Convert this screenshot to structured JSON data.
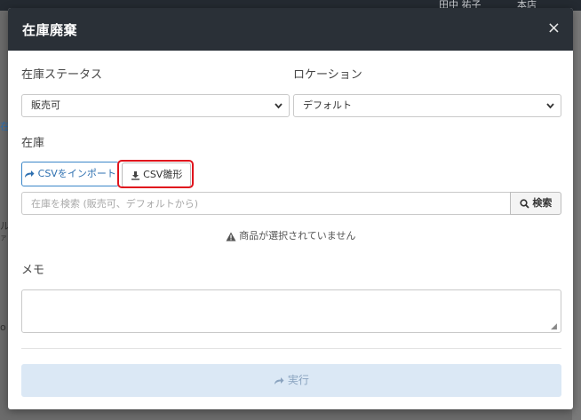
{
  "background": {
    "topbar_user": "田中 祐子",
    "topbar_store": "本店",
    "left_fragments": [
      "在",
      "ル",
      "ァ",
      "o"
    ]
  },
  "modal": {
    "title": "在庫廃棄",
    "close": "×",
    "status_label": "在庫ステータス",
    "status_value": "販売可",
    "location_label": "ロケーション",
    "location_value": "デフォルト",
    "stock_label": "在庫",
    "import_button": "CSVをインポート",
    "template_button": "CSV雛形",
    "search_placeholder": "在庫を検索 (販売可、デフォルトから)",
    "search_button": "検索",
    "warning": "商品が選択されていません",
    "memo_label": "メモ",
    "memo_value": "",
    "execute_button": "実行"
  },
  "colors": {
    "header_bg": "#2a3037",
    "accent_blue": "#2c6fb0",
    "highlight_red": "#e0141d",
    "execute_bg": "#dbe8f5"
  }
}
